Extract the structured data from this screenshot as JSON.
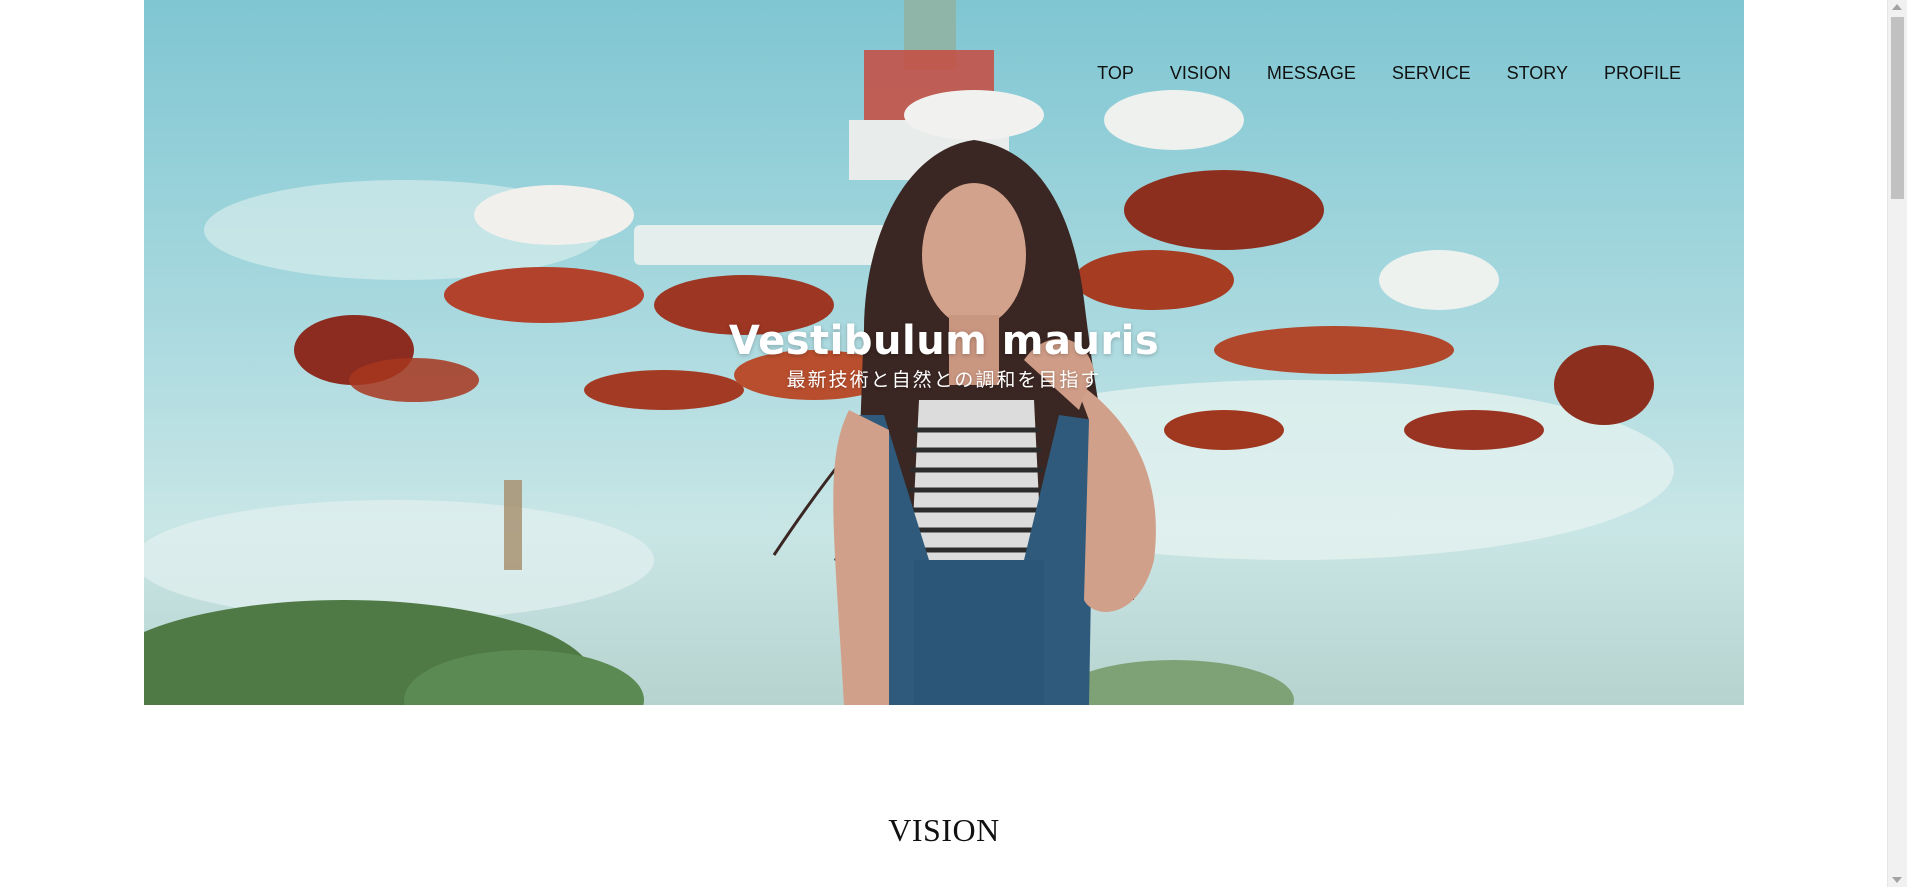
{
  "hero": {
    "title": "Vestibulum mauris",
    "subtitle": "最新技術と自然との調和を目指す",
    "image": "girl-in-overalls-amusement-park-photo"
  },
  "nav": {
    "items": [
      {
        "label": "TOP"
      },
      {
        "label": "VISION"
      },
      {
        "label": "MESSAGE"
      },
      {
        "label": "SERVICE"
      },
      {
        "label": "STORY"
      },
      {
        "label": "PROFILE"
      }
    ]
  },
  "sections": {
    "vision_title": "VISION"
  },
  "colors": {
    "sky": "#8ecfd8",
    "text": "#111111",
    "ride_red": "#b2422c"
  }
}
